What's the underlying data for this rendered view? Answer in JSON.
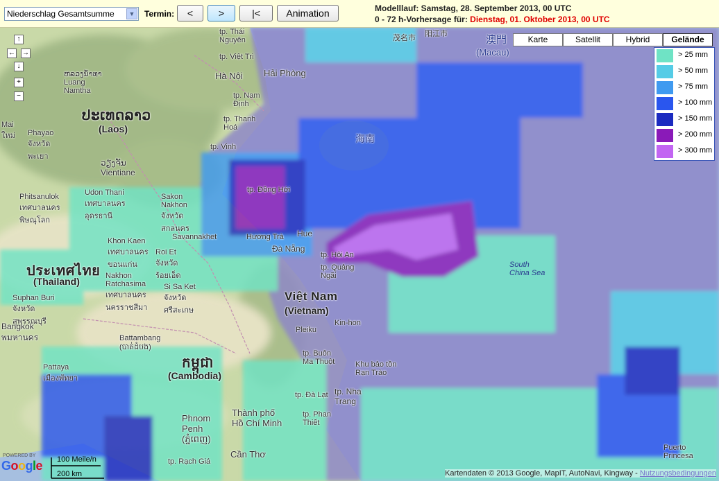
{
  "toolbar": {
    "product": "Niederschlag Gesamtsumme",
    "termin_label": "Termin:",
    "prev_label": "<",
    "next_label": ">",
    "first_label": "|<",
    "animation_label": "Animation",
    "model_run": "Modelllauf: Samstag, 28. September 2013, 00 UTC",
    "forecast_prefix": "0 - 72 h-Vorhersage für: ",
    "forecast_date": "Dienstag, 01. Oktober 2013, 00 UTC"
  },
  "nav": {
    "up": "↑",
    "left": "←",
    "right": "→",
    "down": "↓",
    "zoom_in": "+",
    "zoom_out": "−"
  },
  "map_types": [
    "Karte",
    "Satellit",
    "Hybrid",
    "Gelände"
  ],
  "active_map_type": "Gelände",
  "legend": [
    {
      "label": "> 25 mm",
      "color": "#6fe3c5"
    },
    {
      "label": "> 50 mm",
      "color": "#55cce6"
    },
    {
      "label": "> 75 mm",
      "color": "#3f9af0"
    },
    {
      "label": "> 100 mm",
      "color": "#2a56ee"
    },
    {
      "label": "> 150 mm",
      "color": "#1b2bc0"
    },
    {
      "label": "> 200 mm",
      "color": "#8a1ab8"
    },
    {
      "label": "> 300 mm",
      "color": "#c265f2"
    }
  ],
  "places": {
    "thai_nguyen": "tp. Thái\nNguyên",
    "viet_tri": "tp. Việt Trì",
    "ha_noi": "Hà Nội",
    "hai_phong": "Hải Phòng",
    "nam_dinh": "tp. Nam\nĐịnh",
    "thanh_hoa": "tp. Thanh\nHoá",
    "vinh": "tp. Vinh",
    "dong_hoi": "tp. Đồng Hới",
    "hue": "Hue",
    "huong_tra": "Hương Trà",
    "da_nang": "Đà Nẵng",
    "hoi_an": "tp. Hội An",
    "quang_ngai": "tp. Quảng\nNgãi",
    "kin_hon": "Kin-hon",
    "pleiku": "Pleiku",
    "buon_ma_thuot": "tp. Buôn\nMa Thuột",
    "da_lat": "tp. Đà Lạt",
    "nha_trang": "tp. Nha\nTrang",
    "khu_bao_ton": "Khu bảo tồn\nRạn Trào",
    "phan_thiet": "tp. Phan\nThiết",
    "thanh_pho_hcm": "Thành phố\nHồ Chí Minh",
    "can_tho": "Cần Thơ",
    "rach_gia": "tp. Rạch Giá",
    "phnom_penh": "Phnom\nPenh\n(ភ្នំពេញ)",
    "battambang": "Battambang\n(បាត់ដំបង)",
    "cambodia_native": "កម្ពុជា",
    "cambodia": "(Cambodia)",
    "viet_nam": "Việt Nam",
    "vietnam": "(Vietnam)",
    "laos_native": "ປະເທດລາວ",
    "laos": "(Laos)",
    "thailand_native": "ประเทศไทย",
    "thailand": "(Thailand)",
    "luang_namtha": "ຫລວງນ້ຳທາ\nLuang\nNamtha",
    "vientiane": "ວຽງຈັນ\nVientiane",
    "udon_thani": "Udon Thani\nเทศบาลนคร\nอุดรธานี",
    "sakon_nakhon": "Sakon\nNakhon\nจังหวัด\nสกลนคร",
    "savannakhet": "Savannakhet",
    "khon_kaen": "Khon Kaen\nเทศบาลนคร\nขอนแก่น",
    "roi_et": "Roi Et\nจังหวัด\nร้อยเอ็ด",
    "nakhon_ratchasima": "Nakhon\nRatchasima\nเทศบาลนคร\nนครราชสีมา",
    "si_sa_ket": "Si Sa Ket\nจังหวัด\nศรีสะเกษ",
    "phitsanulok": "Phitsanulok\nเทศบาลนคร\nพิษณุโลก",
    "phayao": "Phayao\nจังหวัด\nพะเยา",
    "mai": "Mai\nใหม่",
    "suphan_buri": "Suphan Buri\nจังหวัด\nสุพรรณบุรี",
    "bangkok": "Bangkok\nพมหานคร",
    "pattaya": "Pattaya\nเมืองพัทยา",
    "hainan": "海南",
    "macau": "(Macau)",
    "macau_native": "澳門",
    "maoming": "茂名市",
    "yangjiang": "阳江市",
    "south_china_sea": "South\nChina Sea",
    "puerto_princesa": "Puerto\nPrincesa"
  },
  "scale": {
    "miles": "100 Meile/n",
    "km": "200 km"
  },
  "branding": {
    "powered": "POWERED BY",
    "logo": "Google"
  },
  "copyright": {
    "text": "Kartendaten © 2013 Google, MapIT, AutoNavi, Kingway - ",
    "link": "Nutzungsbedingungen"
  }
}
